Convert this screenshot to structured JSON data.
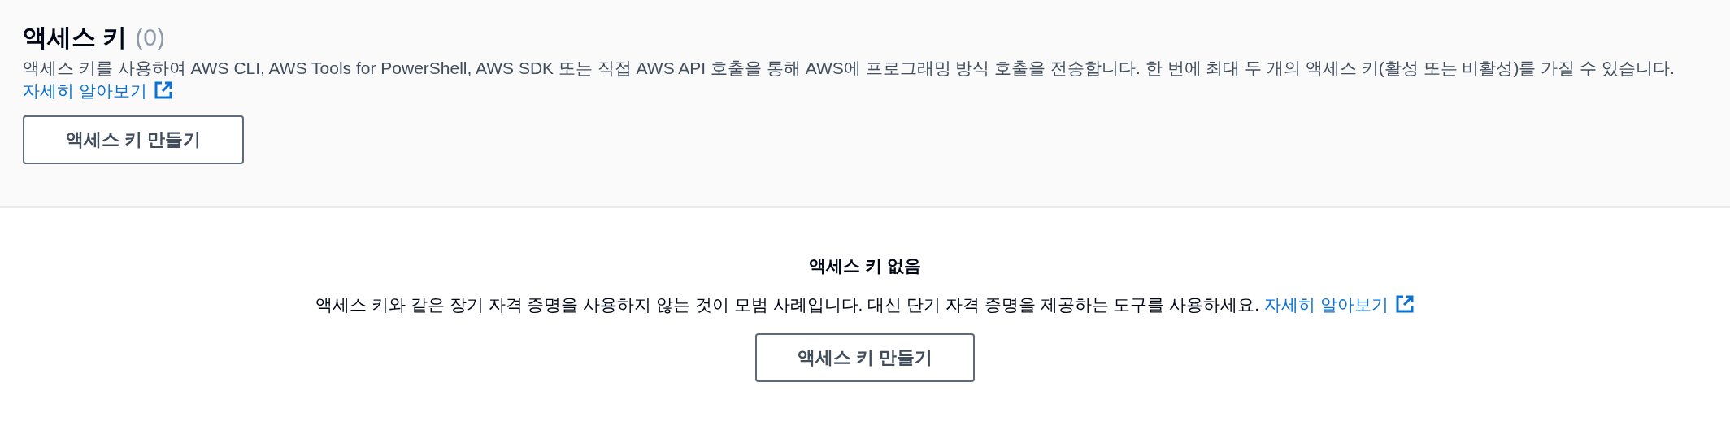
{
  "header": {
    "title": "액세스 키",
    "count": "(0)",
    "description": "액세스 키를 사용하여 AWS CLI, AWS Tools for PowerShell, AWS SDK 또는 직접 AWS API 호출을 통해 AWS에 프로그래밍 방식 호출을 전송합니다. 한 번에 최대 두 개의 액세스 키(활성 또는 비활성)를 가질 수 있습니다.",
    "link": "자세히 알아보기",
    "button": "액세스 키 만들기"
  },
  "empty_state": {
    "title": "액세스 키 없음",
    "description": "액세스 키와 같은 장기 자격 증명을 사용하지 않는 것이 모범 사례입니다. 대신 단기 자격 증명을 제공하는 도구를 사용하세요.",
    "link": "자세히 알아보기",
    "button": "액세스 키 만들기"
  }
}
